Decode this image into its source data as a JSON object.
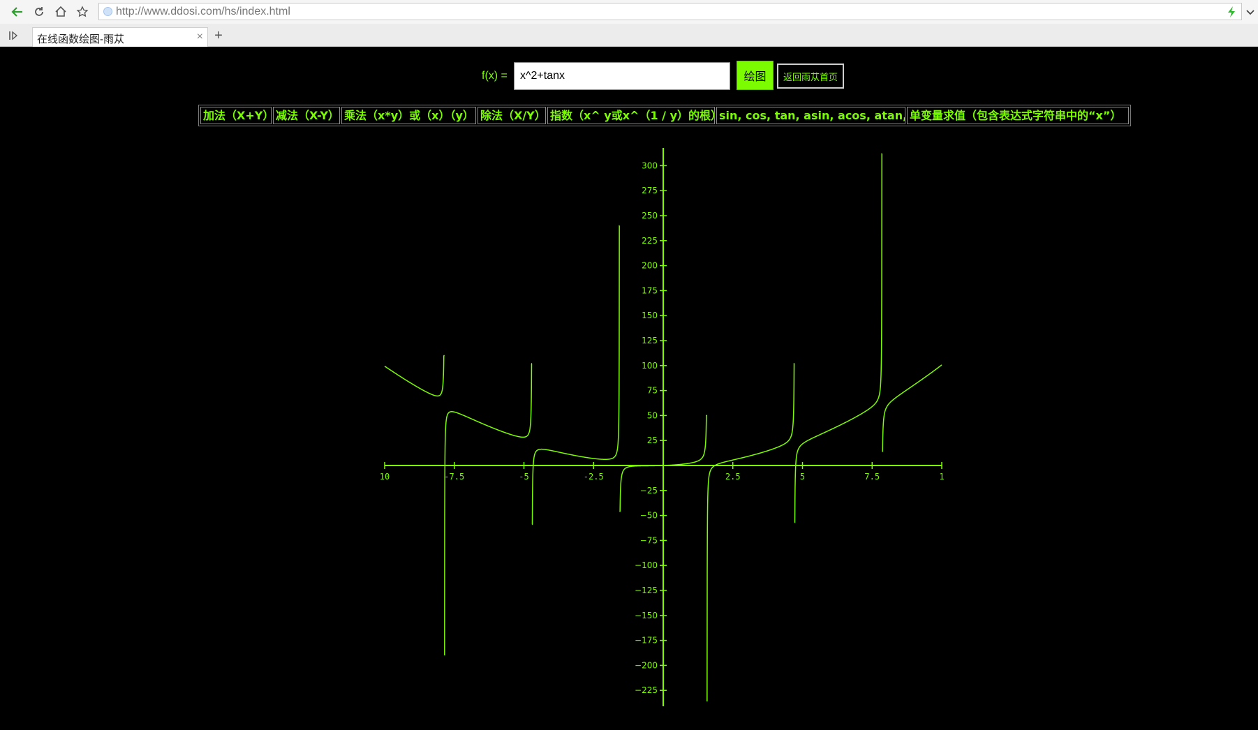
{
  "browser": {
    "url": "http://www.ddosi.com/hs/index.html",
    "tab_title": "在线函数绘图-雨苁",
    "tab_close": "×",
    "new_tab": "+"
  },
  "form": {
    "fx_label": "f(x) =",
    "expression": "x^2+tanx",
    "plot_button": "绘图",
    "home_button": "返回雨苁首页"
  },
  "operations": [
    "加法（X+Y）",
    "减法（X-Y）",
    "乘法（x*y）或（x）（y）",
    "除法（X/Y）",
    "指数（x^ y或x^（1 / y）的根）",
    "sin, cos, tan, asin, acos, atan, abs",
    "单变量求值（包含表达式字符串中的“x”）"
  ],
  "colors": {
    "plot": "#7cfc00",
    "background": "#000000"
  },
  "chart_data": {
    "type": "line",
    "function": "x^2+tanx",
    "xlim": [
      -10,
      10
    ],
    "ylim": [
      -240,
      315
    ],
    "x_tick_labels": [
      "10",
      "-7.5",
      "-5",
      "-2.5",
      "2.5",
      "5",
      "7.5",
      "1"
    ],
    "x_tick_values": [
      -10,
      -7.5,
      -5,
      -2.5,
      2.5,
      5,
      7.5,
      10
    ],
    "y_tick_values": [
      300,
      275,
      250,
      225,
      200,
      175,
      150,
      125,
      100,
      75,
      50,
      25,
      -25,
      -50,
      -75,
      -100,
      -125,
      -150,
      -175,
      -200,
      -225
    ],
    "y_tick_labels": [
      "300",
      "275",
      "250",
      "225",
      "200",
      "175",
      "150",
      "125",
      "100",
      "75",
      "50",
      "25",
      "−25",
      "−50",
      "−75",
      "−100",
      "−125",
      "−150",
      "−175",
      "−200",
      "−225"
    ],
    "grid": false,
    "asymptote_spikes": [
      {
        "x": -7.85,
        "top": 110,
        "bottom": -190
      },
      {
        "x": -4.71,
        "top": 102,
        "bottom": -59
      },
      {
        "x": -1.57,
        "top": 240,
        "bottom": -46
      },
      {
        "x": 1.57,
        "top": 50,
        "bottom": -236
      },
      {
        "x": 4.71,
        "top": 102,
        "bottom": -57
      },
      {
        "x": 7.85,
        "top": 312,
        "bottom": 14
      }
    ]
  }
}
